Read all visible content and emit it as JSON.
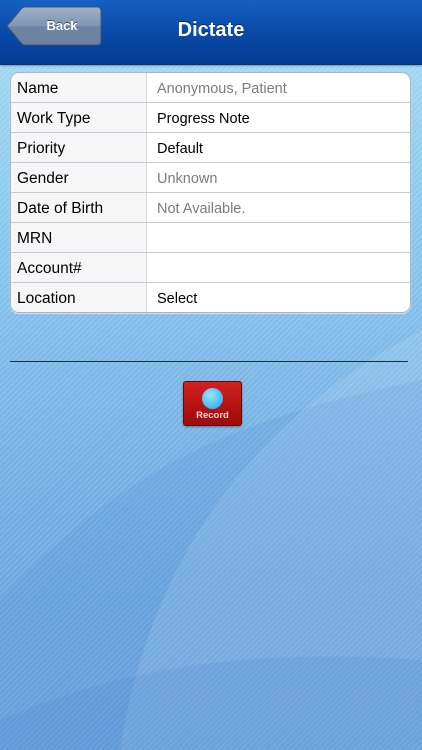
{
  "nav": {
    "title": "Dictate",
    "back_label": "Back"
  },
  "form": {
    "rows": [
      {
        "label": "Name",
        "value": "Anonymous, Patient"
      },
      {
        "label": "Work Type",
        "value": "Progress Note"
      },
      {
        "label": "Priority",
        "value": "Default"
      },
      {
        "label": "Gender",
        "value": "Unknown"
      },
      {
        "label": "Date of Birth",
        "value": "Not Available."
      },
      {
        "label": "MRN",
        "value": ""
      },
      {
        "label": "Account#",
        "value": ""
      },
      {
        "label": "Location",
        "value": "Select"
      }
    ]
  },
  "record": {
    "label": "Record",
    "icon": "record-dot-icon"
  },
  "colors": {
    "navbar": "#0a4aa8",
    "record_button": "#b51313",
    "record_dot": "#4fc2f5",
    "muted_text": "#7c7c7c"
  }
}
